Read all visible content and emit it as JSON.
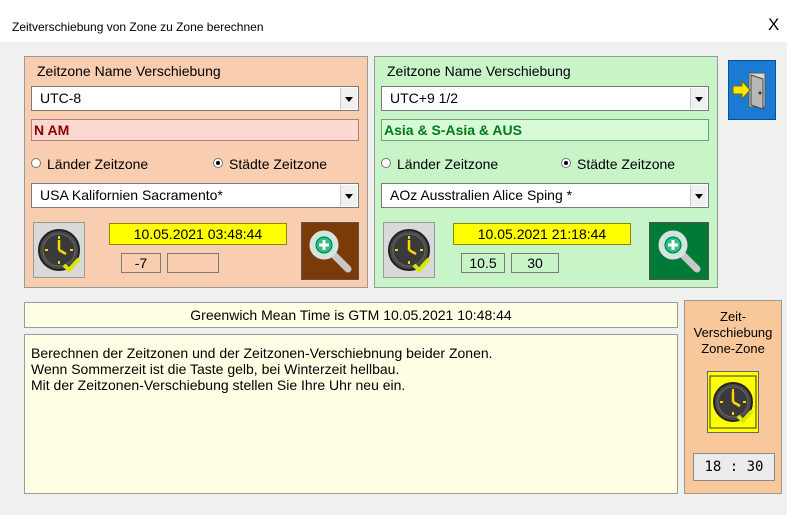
{
  "window": {
    "title": "Zeitverschiebung von Zone zu Zone berechnen",
    "close_glyph": "X"
  },
  "left_zone": {
    "header": "Zeitzone  Name Verschiebung",
    "zone_select": "UTC-8",
    "zone_name": "N AM",
    "radio_countries": "Länder Zeitzone",
    "radio_cities": "Städte Zeitzone",
    "radio_selected": "cities",
    "location_select": "USA Kalifornien Sacramento*",
    "datetime": "10.05.2021 03:48:44",
    "offset_hours": "-7",
    "offset_minutes": "",
    "panel_color": "#f9cdaf",
    "zoom_button_color": "#7b3b09"
  },
  "right_zone": {
    "header": "Zeitzone  Name Verschiebung",
    "zone_select": "UTC+9 1/2",
    "zone_name": "Asia & S-Asia & AUS",
    "radio_countries": "Länder Zeitzone",
    "radio_cities": "Städte Zeitzone",
    "radio_selected": "cities",
    "location_select": "AOz  Ausstralien Alice Sping *",
    "datetime": "10.05.2021 21:18:44",
    "offset_hours": "10.5",
    "offset_minutes": "30",
    "panel_color": "#c8f5c8",
    "zoom_button_color": "#007a37"
  },
  "gmt_text": "Greenwich Mean Time is GTM 10.05.2021 10:48:44",
  "info_lines": [
    "Berechnen der Zeitzonen und der Zeitzonen-Verschiebnung beider Zonen.",
    "Wenn Sommerzeit ist die Taste gelb, bei Winterzeit hellbau.",
    "Mit der Zeitzonen-Verschiebung stellen Sie Ihre Uhr neu ein."
  ],
  "zone_zone": {
    "header_line1": "Zeit-",
    "header_line2": "Verschiebung",
    "header_line3": "Zone-Zone",
    "result": "18 : 30"
  },
  "icons": {
    "clock": "clock-check-icon",
    "zoom": "zoom-plus-icon",
    "exit": "exit-door-icon"
  },
  "colors": {
    "summer_time_yellow": "#ffff00",
    "info_background": "#ffffe6",
    "zone_panel_orange": "#f8c89a",
    "exit_button_blue": "#1a7ad4"
  }
}
